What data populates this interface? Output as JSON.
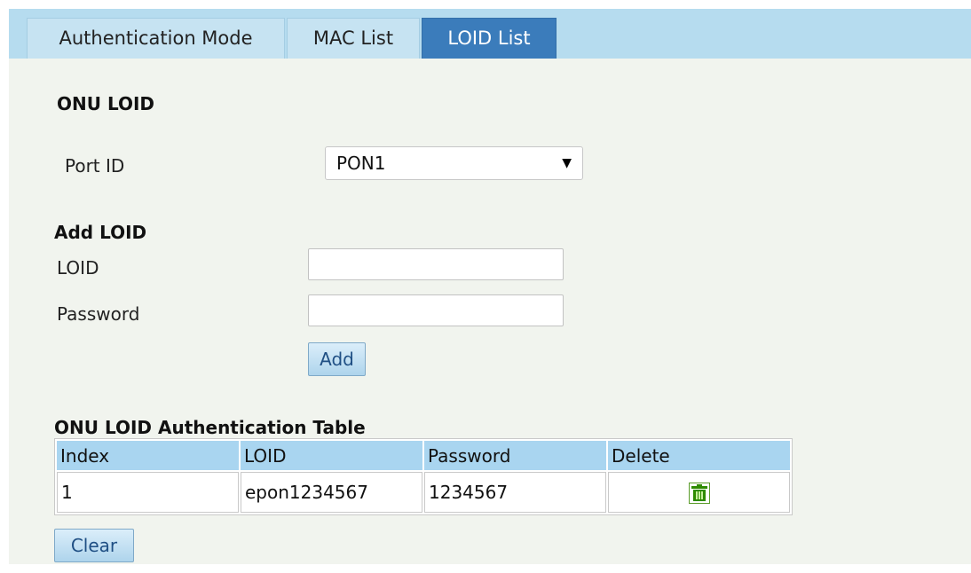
{
  "tabs": [
    {
      "label": "Authentication Mode",
      "active": false
    },
    {
      "label": "MAC List",
      "active": false
    },
    {
      "label": "LOID List",
      "active": true
    }
  ],
  "onu_loid": {
    "title": "ONU LOID",
    "port_label": "Port ID",
    "port_value": "PON1",
    "port_icon": "chevron-down-icon"
  },
  "add_loid": {
    "title": "Add LOID",
    "loid_label": "LOID",
    "loid_value": "",
    "password_label": "Password",
    "password_value": "",
    "add_button": "Add"
  },
  "auth_table": {
    "title": "ONU LOID Authentication Table",
    "columns": [
      "Index",
      "LOID",
      "Password",
      "Delete"
    ],
    "rows": [
      {
        "index": "1",
        "loid": "epon1234567",
        "password": "1234567",
        "delete_icon": "trash-icon"
      }
    ],
    "clear_button": "Clear"
  },
  "colors": {
    "tab_bar": "#b6dcef",
    "tab_active": "#3b7cbb",
    "panel_bg": "#f1f4ee",
    "table_header": "#a9d5f0",
    "delete_icon": "#2e8b00"
  }
}
